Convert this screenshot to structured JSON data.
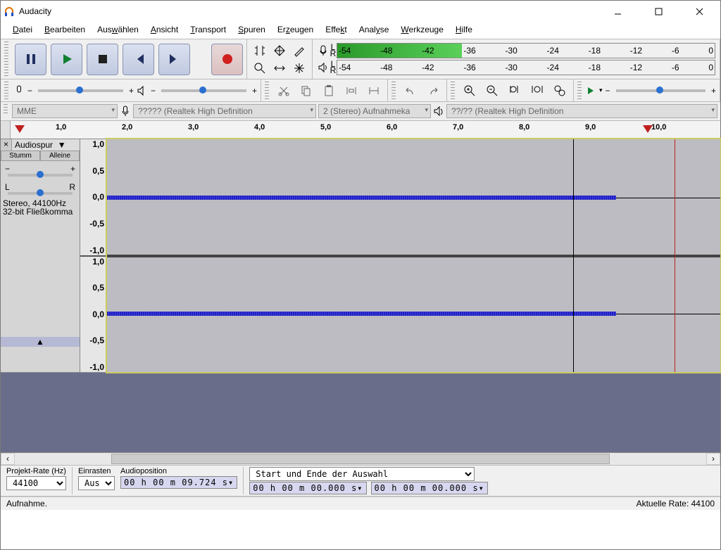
{
  "title": "Audacity",
  "menu": [
    "_Datei",
    "_Bearbeiten",
    "Aus_wählen",
    "_Ansicht",
    "_Transport",
    "_Spuren",
    "Er_zeugen",
    "Effe_kt",
    "Anal_yse",
    "_Werkzeuge",
    "_Hilfe"
  ],
  "meter_labels": [
    "-54",
    "-48",
    "-42",
    "-36",
    "-30",
    "-24",
    "-18",
    "-12",
    "-6",
    "0"
  ],
  "meter_lr": {
    "l": "L",
    "r": "R"
  },
  "devices": {
    "host": "MME",
    "input": "????? (Realtek High Definition",
    "channels": "2 (Stereo) Aufnahmeka",
    "output": "??/?? (Realtek High Definition"
  },
  "timeline": [
    "1,0",
    "2,0",
    "3,0",
    "4,0",
    "5,0",
    "6,0",
    "7,0",
    "8,0",
    "9,0",
    "10,0"
  ],
  "track": {
    "name": "Audiospur",
    "mute": "Stumm",
    "solo": "Alleine",
    "sliders": {
      "l": "L",
      "r": "R",
      "minus": "−",
      "plus": "+"
    },
    "info1": "Stereo, 44100Hz",
    "info2": "32-bit Fließkomma",
    "amp": [
      "1,0",
      "0,5",
      "0,0",
      "-0,5",
      "-1,0"
    ]
  },
  "bottom": {
    "rate_label": "Projekt-Rate (Hz)",
    "rate": "44100",
    "snap_label": "Einrasten",
    "snap": "Aus",
    "pos_label": "Audioposition",
    "pos": "00 h 00 m 09.724 s▾",
    "sel_label": "Start und Ende der Auswahl",
    "sel_start": "00 h 00 m 00.000 s▾",
    "sel_end": "00 h 00 m 00.000 s▾"
  },
  "status": {
    "left": "Aufnahme.",
    "right": "Aktuelle Rate: 44100"
  }
}
